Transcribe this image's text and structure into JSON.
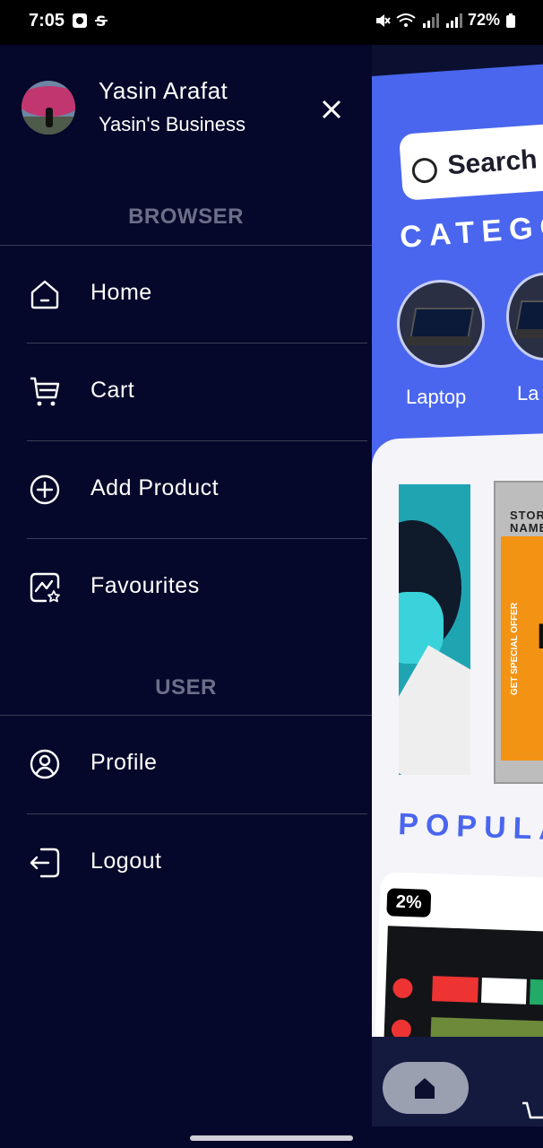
{
  "status_bar": {
    "time": "7:05",
    "battery": "72%"
  },
  "drawer": {
    "user": {
      "name": "Yasin Arafat",
      "business": "Yasin's Business"
    },
    "sections": [
      {
        "title": "BROWSER",
        "items": [
          {
            "label": "Home",
            "icon": "home-icon"
          },
          {
            "label": "Cart",
            "icon": "cart-icon"
          },
          {
            "label": "Add Product",
            "icon": "add-circle-icon"
          },
          {
            "label": "Favourites",
            "icon": "favourites-icon"
          }
        ]
      },
      {
        "title": "USER",
        "items": [
          {
            "label": "Profile",
            "icon": "profile-icon"
          },
          {
            "label": "Logout",
            "icon": "logout-icon"
          }
        ]
      }
    ]
  },
  "background_app": {
    "search_placeholder": "Search",
    "categories_title": "CATEGO",
    "categories": [
      {
        "label": "Laptop"
      },
      {
        "label": "La"
      }
    ],
    "banner_store_text": "STORE NAME",
    "banner_offer_text": "GET SPECIAL OFFER",
    "popular_title": "POPULA",
    "product_discount": "2%",
    "accent_color": "#4a66ee"
  }
}
